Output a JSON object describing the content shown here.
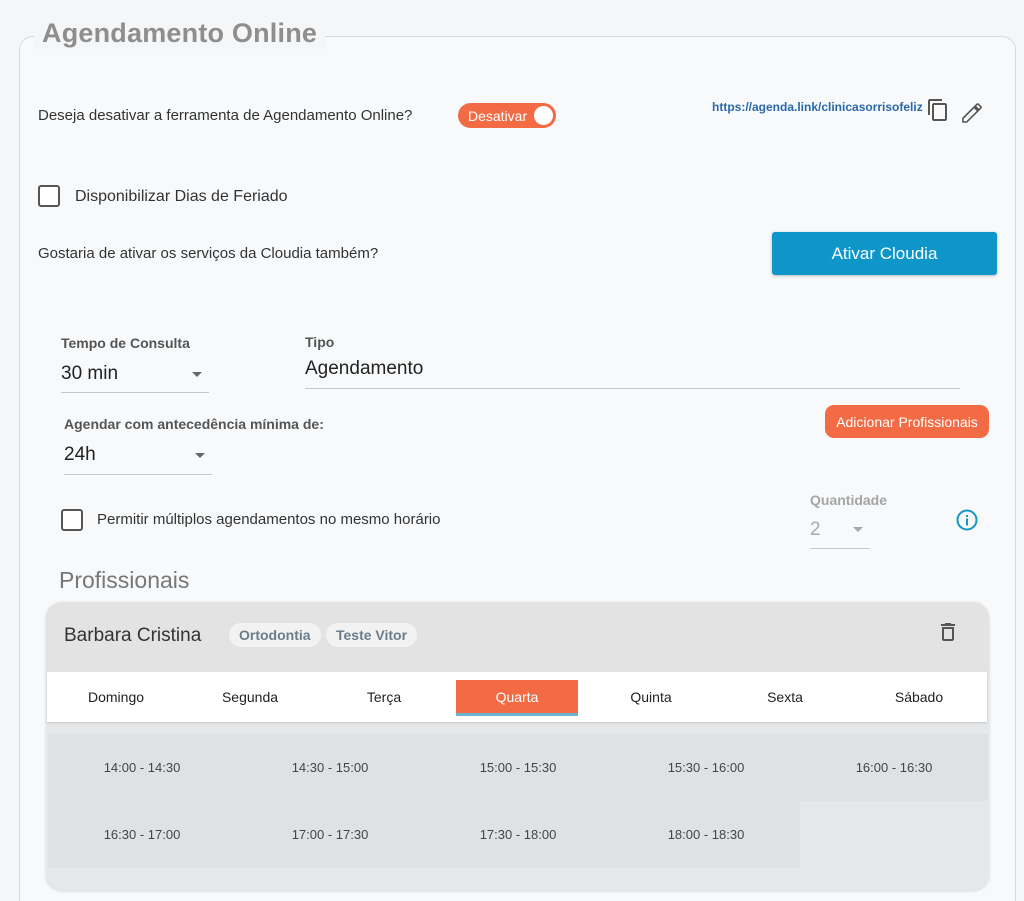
{
  "title": "Agendamento Online",
  "deactivate": {
    "question": "Deseja desativar a ferramenta de Agendamento Online?",
    "toggle_label": "Desativar",
    "link": "https://agenda.link/clinicasorrisofeliz"
  },
  "holiday_label": "Disponibilizar Dias de Feriado",
  "cloudia": {
    "question": "Gostaria de ativar os serviços da Cloudia também?",
    "button": "Ativar Cloudia"
  },
  "consult_time": {
    "label": "Tempo de Consulta",
    "value": "30 min"
  },
  "tipo": {
    "label": "Tipo",
    "value": "Agendamento"
  },
  "advance": {
    "label": "Agendar com antecedência mínima de:",
    "value": "24h"
  },
  "add_professionals": "Adicionar Profissionais",
  "multiple": {
    "label": "Permitir múltiplos agendamentos no mesmo horário"
  },
  "quantidade": {
    "label": "Quantidade",
    "value": "2"
  },
  "professionals_title": "Profissionais",
  "professional": {
    "name": "Barbara Cristina",
    "specialties": [
      "Ortodontia",
      "Teste Vitor"
    ],
    "days": [
      "Domingo",
      "Segunda",
      "Terça",
      "Quarta",
      "Quinta",
      "Sexta",
      "Sábado"
    ],
    "active_day": "Quarta",
    "slots": [
      "14:00 - 14:30",
      "14:30 - 15:00",
      "15:00 - 15:30",
      "15:30 - 16:00",
      "16:00 - 16:30",
      "16:30 - 17:00",
      "17:00 - 17:30",
      "17:30 - 18:00",
      "18:00 - 18:30"
    ]
  },
  "colors": {
    "accent_orange": "#f26b44",
    "accent_blue": "#0f96c8",
    "link_blue": "#2a69a8"
  },
  "icons": [
    "copy-icon",
    "edit-icon",
    "info-icon",
    "trash-icon",
    "chevron-down-icon"
  ]
}
